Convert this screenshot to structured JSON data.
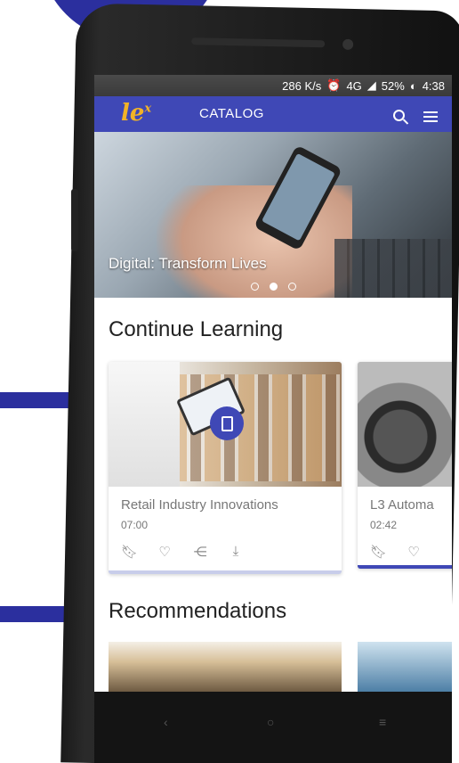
{
  "status_bar": {
    "speed": "286 K/s",
    "alarm_icon": "alarm-icon",
    "network": "4G",
    "battery": "52%",
    "time": "4:38"
  },
  "app_bar": {
    "logo": "le",
    "logo_superscript": "x",
    "title": "CATALOG",
    "icons": [
      "search-icon",
      "menu-icon"
    ]
  },
  "hero": {
    "caption": "Digital: Transform Lives",
    "slides": 3,
    "active_slide": 2
  },
  "continue_learning": {
    "title": "Continue Learning",
    "cards": [
      {
        "title": "Retail Industry Innovations",
        "duration": "07:00",
        "progress": 0
      },
      {
        "title": "L3 Automa",
        "duration": "02:42",
        "progress": 1.0
      }
    ],
    "actions": [
      "bookmark-icon",
      "heart-icon",
      "share-icon",
      "download-icon"
    ]
  },
  "recommendations": {
    "title": "Recommendations"
  },
  "colors": {
    "brand": "#3f48b6",
    "logo": "#f2b327",
    "decor": "#2b2f9e"
  }
}
